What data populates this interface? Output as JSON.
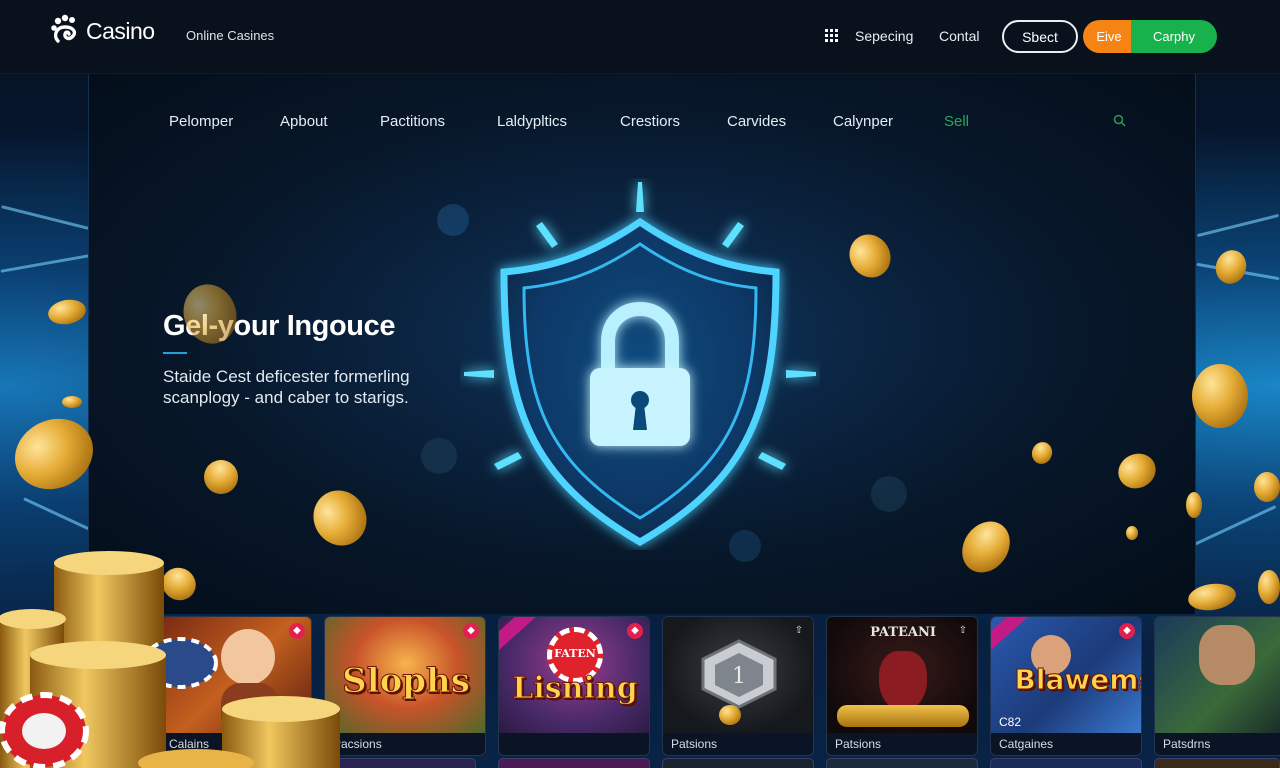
{
  "header": {
    "logo_text": "Casino",
    "tagline": "Online Casines",
    "links": [
      "Sepecing",
      "Contal"
    ],
    "buttons": {
      "outline": "Sbect",
      "orange": "Eive",
      "green": "Carphy"
    }
  },
  "nav": {
    "items": [
      "Pelomper",
      "Apbout",
      "Pactitions",
      "Laldypltics",
      "Crestiors",
      "Carvides",
      "Calynper",
      "Sell"
    ],
    "highlight_color": "#2aa75a"
  },
  "hero": {
    "title": "Gel-your Ingouce",
    "subtitle_line1": "Staide Cest deficester formerling",
    "subtitle_line2": "scanplogy - and caber to starigs.",
    "accent_color": "#22a0e2",
    "icon": "shield-lock-icon"
  },
  "games": [
    {
      "label": "Calains",
      "title": "",
      "badge": "◆"
    },
    {
      "label": "Pacsions",
      "title": "Slophs",
      "badge": "◆"
    },
    {
      "label": "",
      "title": "Lisning",
      "title_small": "FATEN",
      "badge": "◆"
    },
    {
      "label": "Patsions",
      "title": "",
      "badge": "⇧"
    },
    {
      "label": "Patsions",
      "title_small": "PATEANI",
      "badge": "⇧"
    },
    {
      "label": "Catgaines",
      "title": "BlawemsManes",
      "extra_number": "C82",
      "badge": "◆"
    },
    {
      "label": "Patsdrns",
      "title": ""
    }
  ],
  "colors": {
    "topbar": "#08111c",
    "orange": "#f68414",
    "green": "#17b24c",
    "gold": "#e6ad38",
    "cyan": "#38c8ff"
  }
}
